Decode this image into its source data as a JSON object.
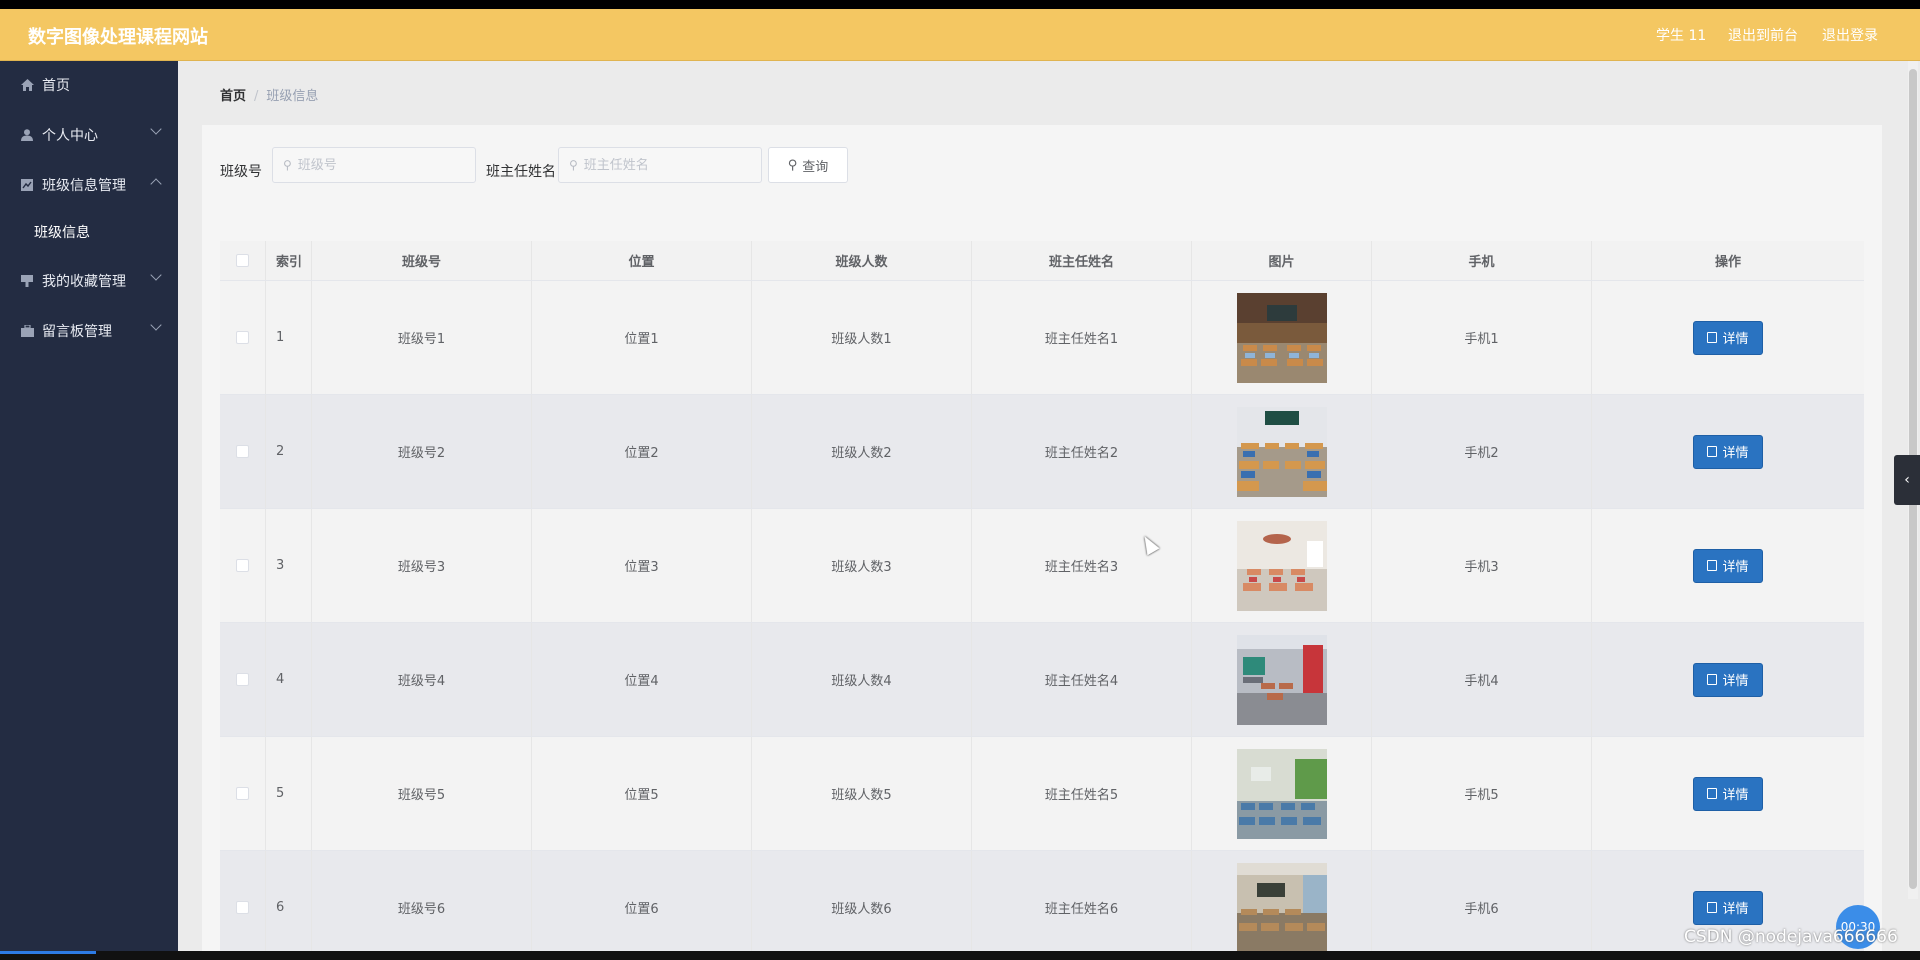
{
  "header": {
    "title": "数字图像处理课程网站",
    "user": "学生 11",
    "to_front": "退出到前台",
    "logout": "退出登录"
  },
  "sidebar": {
    "items": [
      {
        "label": "首页",
        "icon": "home-icon"
      },
      {
        "label": "个人中心",
        "icon": "user-icon"
      },
      {
        "label": "班级信息管理",
        "icon": "chart-icon"
      },
      {
        "label": "我的收藏管理",
        "icon": "flag-icon"
      },
      {
        "label": "留言板管理",
        "icon": "briefcase-icon"
      }
    ],
    "sub_items": [
      {
        "label": "班级信息"
      }
    ]
  },
  "breadcrumb": {
    "home": "首页",
    "separator": "/",
    "current": "班级信息"
  },
  "search": {
    "class_label": "班级号",
    "class_placeholder": "班级号",
    "teacher_label": "班主任姓名",
    "teacher_placeholder": "班主任姓名",
    "button_label": "查询"
  },
  "table": {
    "columns": [
      "索引",
      "班级号",
      "位置",
      "班级人数",
      "班主任姓名",
      "图片",
      "手机",
      "操作"
    ],
    "action_label": "详情",
    "rows": [
      {
        "index": "1",
        "class_no": "班级号1",
        "location": "位置1",
        "count": "班级人数1",
        "teacher": "班主任姓名1",
        "phone": "手机1"
      },
      {
        "index": "2",
        "class_no": "班级号2",
        "location": "位置2",
        "count": "班级人数2",
        "teacher": "班主任姓名2",
        "phone": "手机2"
      },
      {
        "index": "3",
        "class_no": "班级号3",
        "location": "位置3",
        "count": "班级人数3",
        "teacher": "班主任姓名3",
        "phone": "手机3"
      },
      {
        "index": "4",
        "class_no": "班级号4",
        "location": "位置4",
        "count": "班级人数4",
        "teacher": "班主任姓名4",
        "phone": "手机4"
      },
      {
        "index": "5",
        "class_no": "班级号5",
        "location": "位置5",
        "count": "班级人数5",
        "teacher": "班主任姓名5",
        "phone": "手机5"
      },
      {
        "index": "6",
        "class_no": "班级号6",
        "location": "位置6",
        "count": "班级人数6",
        "teacher": "班主任姓名6",
        "phone": "手机6"
      }
    ]
  },
  "overlay": {
    "timer": "00:30",
    "watermark": "CSDN @nodejava666666"
  },
  "colors": {
    "header": "#f4c762",
    "sidebar": "#232c42",
    "primary_button": "#2a73c1"
  }
}
